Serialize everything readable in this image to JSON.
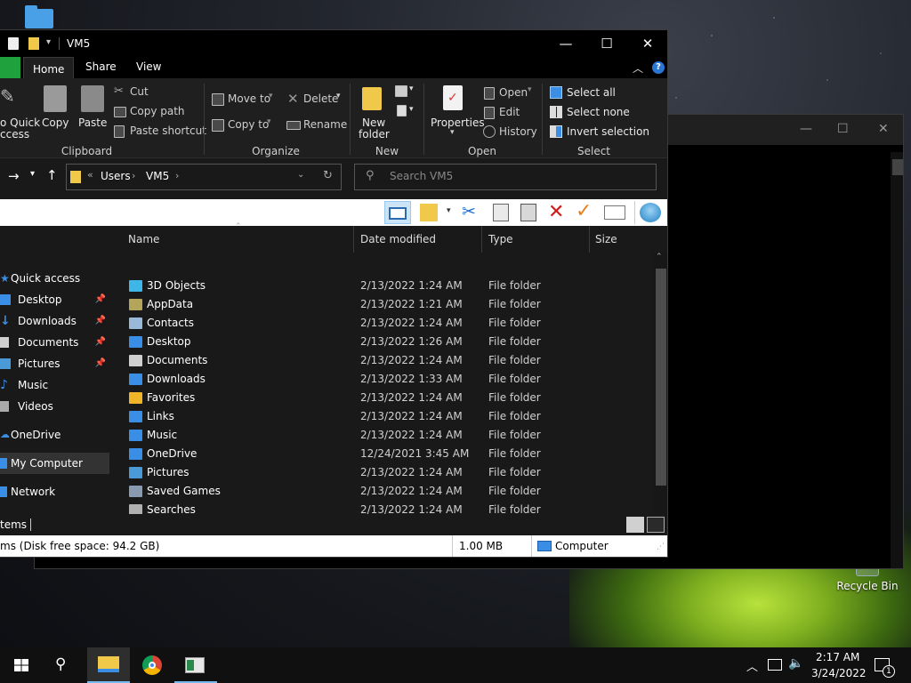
{
  "window": {
    "title": "VM5",
    "tabs": [
      "Home",
      "Share",
      "View"
    ],
    "active_tab": "Home"
  },
  "ribbon": {
    "clipboard": {
      "pin_label_1": "o Quick",
      "pin_label_2": "ccess",
      "copy": "Copy",
      "paste": "Paste",
      "cut": "Cut",
      "copy_path": "Copy path",
      "paste_shortcut": "Paste shortcut",
      "group": "Clipboard"
    },
    "organize": {
      "move_to": "Move to",
      "copy_to": "Copy to",
      "delete": "Delete",
      "rename": "Rename",
      "group": "Organize"
    },
    "new": {
      "new_folder_1": "New",
      "new_folder_2": "folder",
      "group": "New"
    },
    "open": {
      "properties": "Properties",
      "open": "Open",
      "edit": "Edit",
      "history": "History",
      "group": "Open"
    },
    "select": {
      "select_all": "Select all",
      "select_none": "Select none",
      "invert": "Invert selection",
      "group": "Select"
    }
  },
  "address": {
    "prefix": "«",
    "crumb1": "Users",
    "crumb2": "VM5",
    "search_placeholder": "Search VM5"
  },
  "nav": [
    {
      "label": "Quick access",
      "icon": "star-icon",
      "color": "#3a8ee6",
      "pinned": false,
      "selected": false
    },
    {
      "label": "Desktop",
      "icon": "desktop-icon",
      "color": "#3a8ee6",
      "pinned": true,
      "selected": false
    },
    {
      "label": "Downloads",
      "icon": "download-icon",
      "color": "#3a8ee6",
      "pinned": true,
      "selected": false
    },
    {
      "label": "Documents",
      "icon": "document-icon",
      "color": "#cfcfcf",
      "pinned": true,
      "selected": false
    },
    {
      "label": "Pictures",
      "icon": "picture-icon",
      "color": "#4a9ad8",
      "pinned": true,
      "selected": false
    },
    {
      "label": "Music",
      "icon": "music-icon",
      "color": "#3a8ee6",
      "pinned": false,
      "selected": false
    },
    {
      "label": "Videos",
      "icon": "video-icon",
      "color": "#aaaaaa",
      "pinned": false,
      "selected": false
    },
    {
      "label": "OneDrive",
      "icon": "cloud-icon",
      "color": "#3a8ee6",
      "pinned": false,
      "selected": false
    },
    {
      "label": "My Computer",
      "icon": "computer-icon",
      "color": "#3a8ee6",
      "pinned": false,
      "selected": true
    },
    {
      "label": "Network",
      "icon": "network-icon",
      "color": "#3a8ee6",
      "pinned": false,
      "selected": false
    }
  ],
  "columns": {
    "name": "Name",
    "date": "Date modified",
    "type": "Type",
    "size": "Size"
  },
  "files": [
    {
      "name": "3D Objects",
      "date": "2/13/2022 1:24 AM",
      "type": "File folder",
      "icon": "cube-icon",
      "color": "#3fb6e8"
    },
    {
      "name": "AppData",
      "date": "2/13/2022 1:21 AM",
      "type": "File folder",
      "icon": "folder-icon",
      "color": "#b3a65a"
    },
    {
      "name": "Contacts",
      "date": "2/13/2022 1:24 AM",
      "type": "File folder",
      "icon": "contacts-icon",
      "color": "#9ab8d8"
    },
    {
      "name": "Desktop",
      "date": "2/13/2022 1:26 AM",
      "type": "File folder",
      "icon": "desktop-icon",
      "color": "#3a8ee6"
    },
    {
      "name": "Documents",
      "date": "2/13/2022 1:24 AM",
      "type": "File folder",
      "icon": "document-icon",
      "color": "#cfcfcf"
    },
    {
      "name": "Downloads",
      "date": "2/13/2022 1:33 AM",
      "type": "File folder",
      "icon": "download-icon",
      "color": "#3a8ee6"
    },
    {
      "name": "Favorites",
      "date": "2/13/2022 1:24 AM",
      "type": "File folder",
      "icon": "star-icon",
      "color": "#f0b429"
    },
    {
      "name": "Links",
      "date": "2/13/2022 1:24 AM",
      "type": "File folder",
      "icon": "link-icon",
      "color": "#3a8ee6"
    },
    {
      "name": "Music",
      "date": "2/13/2022 1:24 AM",
      "type": "File folder",
      "icon": "music-icon",
      "color": "#3a8ee6"
    },
    {
      "name": "OneDrive",
      "date": "12/24/2021 3:45 AM",
      "type": "File folder",
      "icon": "cloud-icon",
      "color": "#3a8ee6"
    },
    {
      "name": "Pictures",
      "date": "2/13/2022 1:24 AM",
      "type": "File folder",
      "icon": "picture-icon",
      "color": "#4a9ad8"
    },
    {
      "name": "Saved Games",
      "date": "2/13/2022 1:24 AM",
      "type": "File folder",
      "icon": "games-icon",
      "color": "#8a9ab0"
    },
    {
      "name": "Searches",
      "date": "2/13/2022 1:24 AM",
      "type": "File folder",
      "icon": "search-icon",
      "color": "#b0b0b0"
    }
  ],
  "status": {
    "items": "tems",
    "disk": "ms (Disk free space: 94.2 GB)",
    "size": "1.00 MB",
    "location": "Computer"
  },
  "desktop": {
    "recycle_bin": "Recycle Bin"
  },
  "taskbar": {
    "time": "2:17 AM",
    "date": "3/24/2022",
    "notif_count": "1"
  },
  "colors": {
    "accent": "#76b9ed",
    "file_tab": "#1fa13d",
    "delete_x": "#d11a1a",
    "check": "#e8801f"
  }
}
